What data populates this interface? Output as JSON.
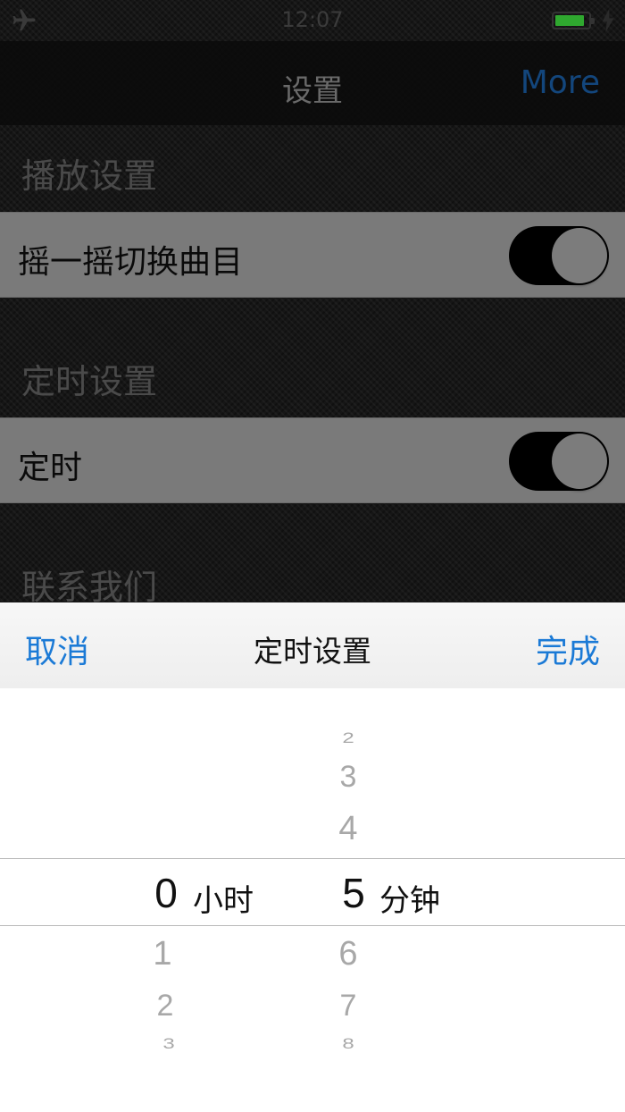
{
  "status_bar": {
    "time": "12:07"
  },
  "nav": {
    "title": "设置",
    "more": "More"
  },
  "sections": [
    {
      "header": "播放设置",
      "row_label": "摇一摇切换曲目"
    },
    {
      "header": "定时设置",
      "row_label": "定时"
    },
    {
      "header": "联系我们"
    }
  ],
  "picker_sheet": {
    "cancel": "取消",
    "title": "定时设置",
    "done": "完成",
    "hours": {
      "above": [],
      "selected": "0",
      "below": [
        "1",
        "2",
        "3"
      ],
      "unit": "小时"
    },
    "minutes": {
      "above": [
        "2",
        "3",
        "4"
      ],
      "selected": "5",
      "below": [
        "6",
        "7",
        "8"
      ],
      "unit": "分钟"
    }
  }
}
